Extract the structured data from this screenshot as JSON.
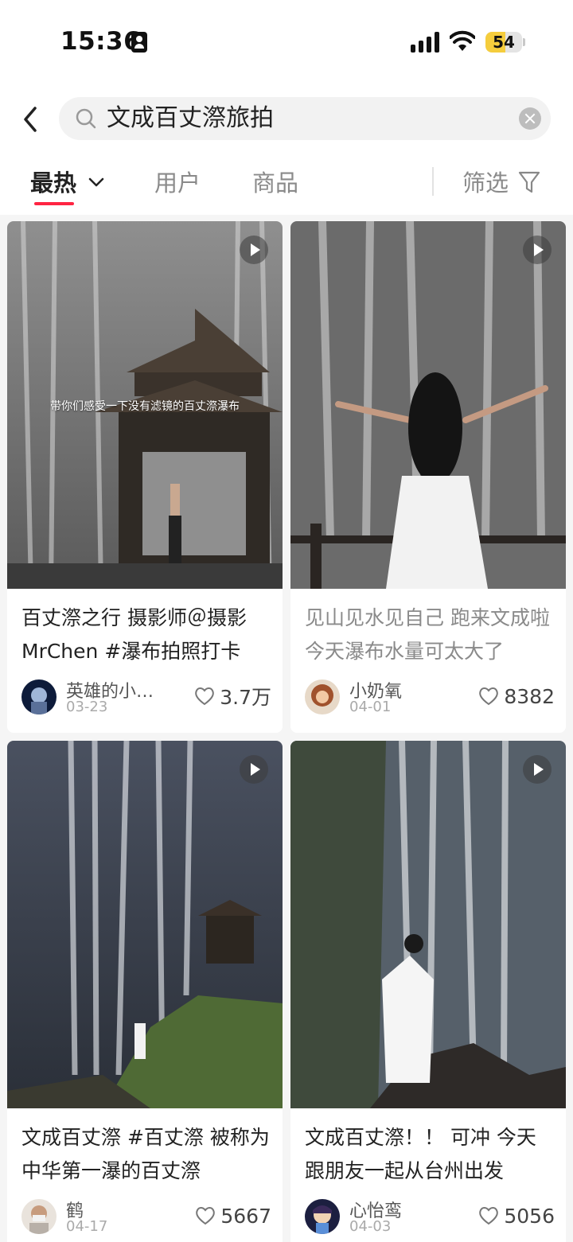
{
  "status_bar": {
    "time": "15:36",
    "battery": "54",
    "battery_level": 0.54
  },
  "search": {
    "query": "文成百丈漈旅拍"
  },
  "tabs": [
    {
      "label": "最热"
    },
    {
      "label": "用户"
    },
    {
      "label": "商品"
    },
    {
      "label": "筛选"
    }
  ],
  "colors": {
    "accent": "#ff2442"
  },
  "feed": [
    {
      "image_caption": "带你们感受一下没有滤镜的百丈漈瀑布",
      "title": "百丈漈之行 摄影师＠摄影MrChen #瀑布拍照打卡",
      "author": "英雄的小石头",
      "date": "03-23",
      "likes": "3.7万"
    },
    {
      "title": "见山见水见自己 跑来文成啦 今天瀑布水量可太大了",
      "author": "小奶氧",
      "date": "04-01",
      "likes": "8382"
    },
    {
      "title": "文成百丈漈 #百丈漈  被称为中华第一瀑的百丈漈",
      "author": "鹤",
      "date": "04-17",
      "likes": "5667"
    },
    {
      "title": "文成百丈漈！！ 可冲 今天跟朋友一起从台州出发",
      "author": "心怡鸾",
      "date": "04-03",
      "likes": "5056"
    }
  ]
}
